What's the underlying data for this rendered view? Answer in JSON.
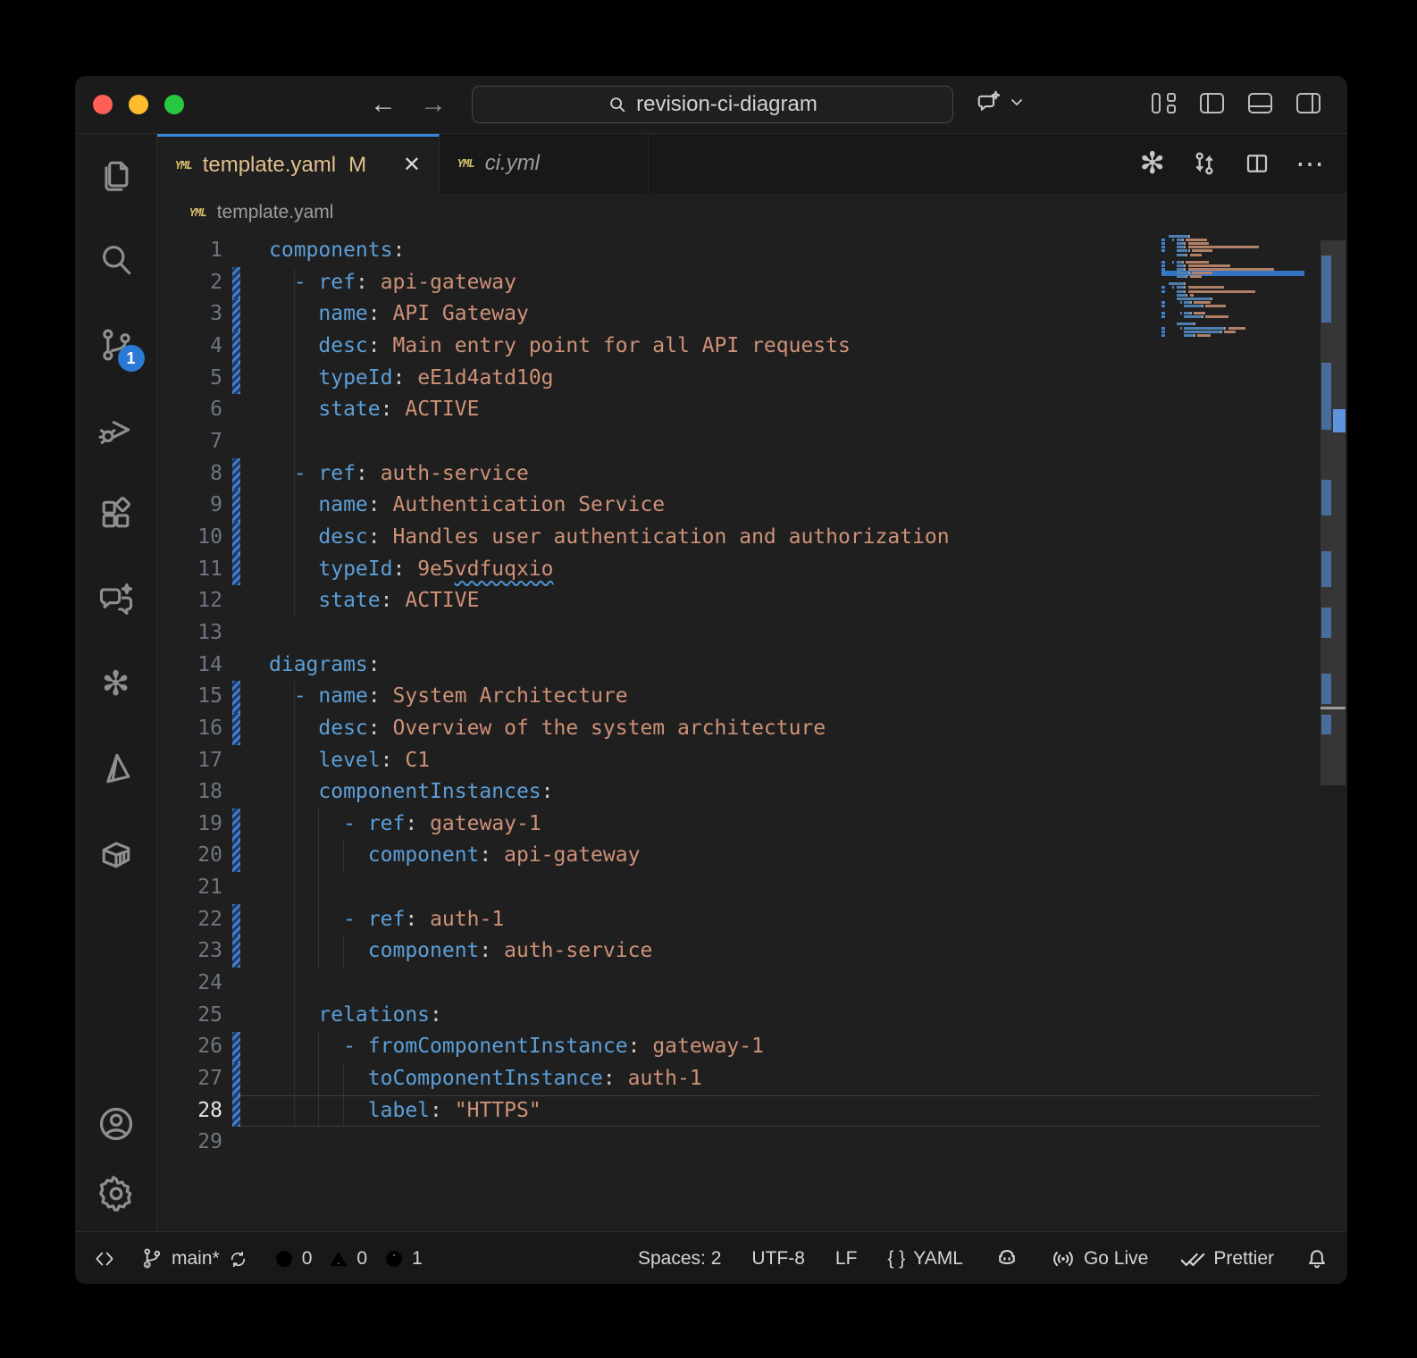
{
  "title_bar": {
    "search_value": "revision-ci-diagram"
  },
  "tabs": [
    {
      "label": "template.yaml",
      "git_badge": "M"
    },
    {
      "label": "ci.yml"
    }
  ],
  "breadcrumb": {
    "file": "template.yaml"
  },
  "activity_bar": {
    "scm_badge": "1"
  },
  "editor": {
    "current_line": 28,
    "lines": [
      {
        "n": 1,
        "mod": false,
        "parts": [
          [
            "k",
            "components"
          ],
          [
            "p",
            ":"
          ]
        ]
      },
      {
        "n": 2,
        "mod": true,
        "parts": [
          [
            "w",
            "  "
          ],
          [
            "k",
            "-"
          ],
          [
            "w",
            " "
          ],
          [
            "k",
            "ref"
          ],
          [
            "p",
            ":"
          ],
          [
            "w",
            " "
          ],
          [
            "v",
            "api-gateway"
          ]
        ]
      },
      {
        "n": 3,
        "mod": true,
        "parts": [
          [
            "w",
            "    "
          ],
          [
            "k",
            "name"
          ],
          [
            "p",
            ":"
          ],
          [
            "w",
            " "
          ],
          [
            "v",
            "API Gateway"
          ]
        ]
      },
      {
        "n": 4,
        "mod": true,
        "parts": [
          [
            "w",
            "    "
          ],
          [
            "k",
            "desc"
          ],
          [
            "p",
            ":"
          ],
          [
            "w",
            " "
          ],
          [
            "v",
            "Main entry point for all API requests"
          ]
        ]
      },
      {
        "n": 5,
        "mod": true,
        "parts": [
          [
            "w",
            "    "
          ],
          [
            "k",
            "typeId"
          ],
          [
            "p",
            ":"
          ],
          [
            "w",
            " "
          ],
          [
            "v",
            "eE1d4atd10g"
          ]
        ]
      },
      {
        "n": 6,
        "mod": false,
        "parts": [
          [
            "w",
            "    "
          ],
          [
            "k",
            "state"
          ],
          [
            "p",
            ":"
          ],
          [
            "w",
            " "
          ],
          [
            "v",
            "ACTIVE"
          ]
        ]
      },
      {
        "n": 7,
        "mod": false,
        "parts": []
      },
      {
        "n": 8,
        "mod": true,
        "parts": [
          [
            "w",
            "  "
          ],
          [
            "k",
            "-"
          ],
          [
            "w",
            " "
          ],
          [
            "k",
            "ref"
          ],
          [
            "p",
            ":"
          ],
          [
            "w",
            " "
          ],
          [
            "v",
            "auth-service"
          ]
        ]
      },
      {
        "n": 9,
        "mod": true,
        "parts": [
          [
            "w",
            "    "
          ],
          [
            "k",
            "name"
          ],
          [
            "p",
            ":"
          ],
          [
            "w",
            " "
          ],
          [
            "v",
            "Authentication Service"
          ]
        ]
      },
      {
        "n": 10,
        "mod": true,
        "parts": [
          [
            "w",
            "    "
          ],
          [
            "k",
            "desc"
          ],
          [
            "p",
            ":"
          ],
          [
            "w",
            " "
          ],
          [
            "v",
            "Handles user authentication and authorization"
          ]
        ]
      },
      {
        "n": 11,
        "mod": true,
        "parts": [
          [
            "w",
            "    "
          ],
          [
            "k",
            "typeId"
          ],
          [
            "p",
            ":"
          ],
          [
            "w",
            " "
          ],
          [
            "v",
            "9e5"
          ],
          [
            "q",
            "vdfuqxio"
          ]
        ]
      },
      {
        "n": 12,
        "mod": false,
        "parts": [
          [
            "w",
            "    "
          ],
          [
            "k",
            "state"
          ],
          [
            "p",
            ":"
          ],
          [
            "w",
            " "
          ],
          [
            "v",
            "ACTIVE"
          ]
        ]
      },
      {
        "n": 13,
        "mod": false,
        "parts": []
      },
      {
        "n": 14,
        "mod": false,
        "parts": [
          [
            "k",
            "diagrams"
          ],
          [
            "p",
            ":"
          ]
        ]
      },
      {
        "n": 15,
        "mod": true,
        "parts": [
          [
            "w",
            "  "
          ],
          [
            "k",
            "-"
          ],
          [
            "w",
            " "
          ],
          [
            "k",
            "name"
          ],
          [
            "p",
            ":"
          ],
          [
            "w",
            " "
          ],
          [
            "v",
            "System Architecture"
          ]
        ]
      },
      {
        "n": 16,
        "mod": true,
        "parts": [
          [
            "w",
            "    "
          ],
          [
            "k",
            "desc"
          ],
          [
            "p",
            ":"
          ],
          [
            "w",
            " "
          ],
          [
            "v",
            "Overview of the system architecture"
          ]
        ]
      },
      {
        "n": 17,
        "mod": false,
        "parts": [
          [
            "w",
            "    "
          ],
          [
            "k",
            "level"
          ],
          [
            "p",
            ":"
          ],
          [
            "w",
            " "
          ],
          [
            "v",
            "C1"
          ]
        ]
      },
      {
        "n": 18,
        "mod": false,
        "parts": [
          [
            "w",
            "    "
          ],
          [
            "k",
            "componentInstances"
          ],
          [
            "p",
            ":"
          ]
        ]
      },
      {
        "n": 19,
        "mod": true,
        "parts": [
          [
            "w",
            "      "
          ],
          [
            "k",
            "-"
          ],
          [
            "w",
            " "
          ],
          [
            "k",
            "ref"
          ],
          [
            "p",
            ":"
          ],
          [
            "w",
            " "
          ],
          [
            "v",
            "gateway-1"
          ]
        ]
      },
      {
        "n": 20,
        "mod": true,
        "parts": [
          [
            "w",
            "        "
          ],
          [
            "k",
            "component"
          ],
          [
            "p",
            ":"
          ],
          [
            "w",
            " "
          ],
          [
            "v",
            "api-gateway"
          ]
        ]
      },
      {
        "n": 21,
        "mod": false,
        "parts": []
      },
      {
        "n": 22,
        "mod": true,
        "parts": [
          [
            "w",
            "      "
          ],
          [
            "k",
            "-"
          ],
          [
            "w",
            " "
          ],
          [
            "k",
            "ref"
          ],
          [
            "p",
            ":"
          ],
          [
            "w",
            " "
          ],
          [
            "v",
            "auth-1"
          ]
        ]
      },
      {
        "n": 23,
        "mod": true,
        "parts": [
          [
            "w",
            "        "
          ],
          [
            "k",
            "component"
          ],
          [
            "p",
            ":"
          ],
          [
            "w",
            " "
          ],
          [
            "v",
            "auth-service"
          ]
        ]
      },
      {
        "n": 24,
        "mod": false,
        "parts": []
      },
      {
        "n": 25,
        "mod": false,
        "parts": [
          [
            "w",
            "    "
          ],
          [
            "k",
            "relations"
          ],
          [
            "p",
            ":"
          ]
        ]
      },
      {
        "n": 26,
        "mod": true,
        "parts": [
          [
            "w",
            "      "
          ],
          [
            "k",
            "-"
          ],
          [
            "w",
            " "
          ],
          [
            "k",
            "fromComponentInstance"
          ],
          [
            "p",
            ":"
          ],
          [
            "w",
            " "
          ],
          [
            "v",
            "gateway-1"
          ]
        ]
      },
      {
        "n": 27,
        "mod": true,
        "parts": [
          [
            "w",
            "        "
          ],
          [
            "k",
            "toComponentInstance"
          ],
          [
            "p",
            ":"
          ],
          [
            "w",
            " "
          ],
          [
            "v",
            "auth-1"
          ]
        ]
      },
      {
        "n": 28,
        "mod": true,
        "parts": [
          [
            "w",
            "        "
          ],
          [
            "k",
            "label"
          ],
          [
            "p",
            ":"
          ],
          [
            "w",
            " "
          ],
          [
            "v",
            "\"HTTPS\""
          ]
        ]
      },
      {
        "n": 29,
        "mod": false,
        "parts": []
      }
    ]
  },
  "status_bar": {
    "branch": "main*",
    "errors": "0",
    "warnings": "0",
    "infos": "1",
    "indent": "Spaces: 2",
    "encoding": "UTF-8",
    "eol": "LF",
    "braces": "{ }",
    "language": "YAML",
    "go_live": "Go Live",
    "formatter": "Prettier"
  },
  "colors": {
    "accent_blue": "#3b86d8",
    "key": "#5c9fd8",
    "value": "#ce9178",
    "modified_label": "#e2c08d"
  }
}
